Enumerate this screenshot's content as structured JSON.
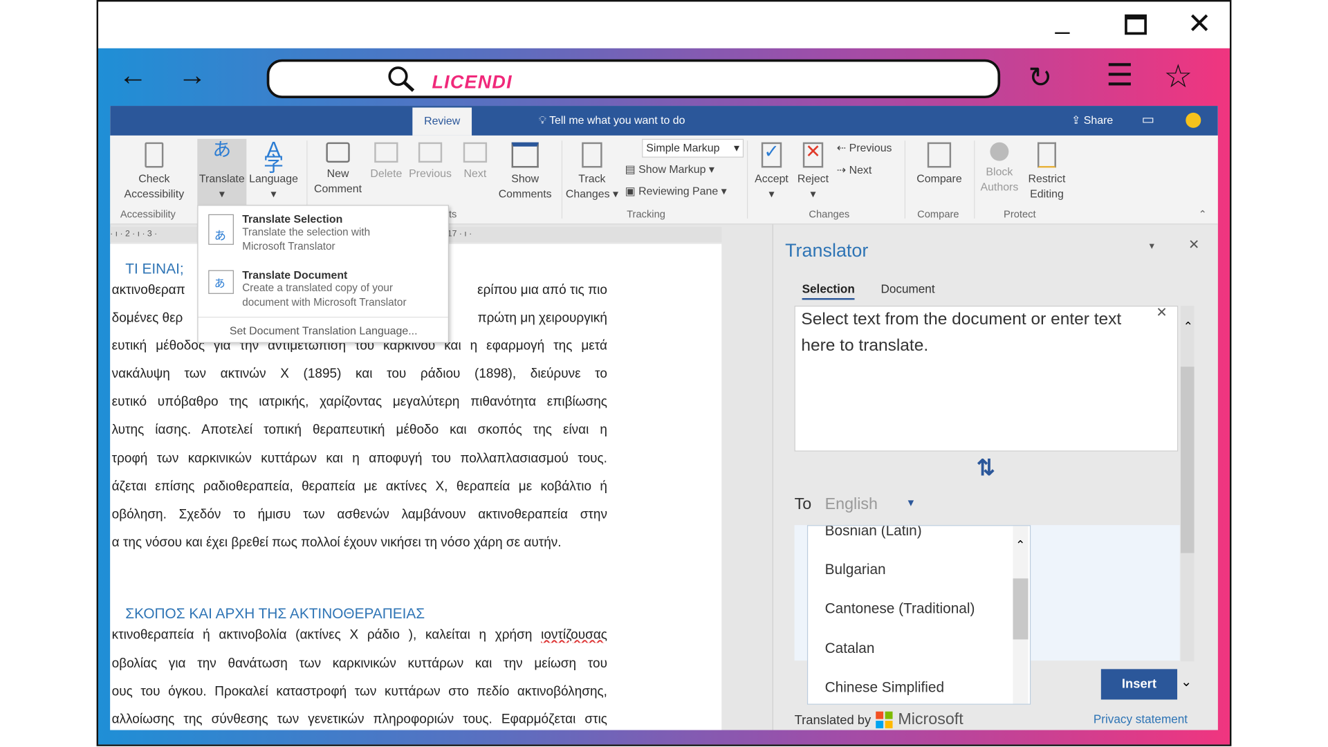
{
  "browser": {
    "logo": "LICENDI",
    "icons": [
      "back-arrow",
      "forward-arrow",
      "search",
      "reload",
      "hamburger-menu",
      "star",
      "minimize",
      "maximize",
      "close"
    ]
  },
  "word": {
    "active_tab": "Review",
    "tell_me": "Tell me what you want to do",
    "share": "Share",
    "ribbon": {
      "check_accessibility": "Check Accessibility",
      "translate": "Translate",
      "language": "Language",
      "new_comment": "New Comment",
      "delete": "Delete",
      "previous": "Previous",
      "next": "Next",
      "show_comments": "Show Comments",
      "track_changes": "Track Changes",
      "simple_markup": "Simple Markup",
      "show_markup": "Show Markup",
      "reviewing_pane": "Reviewing Pane",
      "accept": "Accept",
      "reject": "Reject",
      "prev_change": "Previous",
      "next_change": "Next",
      "compare": "Compare",
      "block_authors": "Block Authors",
      "restrict_editing": "Restrict Editing",
      "groups": {
        "accessibility": "Accessibility",
        "comments_tail": "ts",
        "tracking": "Tracking",
        "changes": "Changes",
        "compare": "Compare",
        "protect": "Protect"
      }
    },
    "ruler": "· ı · 2 · ı · 3 ·                                                   ı · 11 · ı · 12 · ı · 13 · ı · 14 · ı · 15 · ı · 16 · ı · 17 · ı ·",
    "translate_menu": {
      "selection_title": "Translate Selection",
      "selection_desc": "Translate the selection with Microsoft Translator",
      "document_title": "Translate Document",
      "document_desc": "Create a translated copy of your document with Microsoft Translator",
      "set_language": "Set Document Translation Language..."
    },
    "document": {
      "heading1": "ΤΙ ΕΙΝΑΙ;",
      "p1_l1a": "ακτινοθεραπ",
      "p1_l1b": "ερίπου μια από τις πιο",
      "p1_l2a": "δομένες θερ",
      "p1_l2b": "πρώτη μη χειρουργική",
      "p1": [
        "ευτική μέθοδος για την αντιμετώπιση του καρκίνου και η εφαρμογή της μετά",
        "νακάλυψη των ακτινών Χ (1895) και του ράδιου (1898), διεύρυνε το",
        "ευτικό υπόβαθρο της ιατρικής, χαρίζοντας μεγαλύτερη πιθανότητα επιβίωσης",
        "λυτης ίασης.  Αποτελεί τοπική θεραπευτική μέθοδο και σκοπός της είναι η",
        "τροφή των καρκινικών κυττάρων και η αποφυγή του πολλαπλασιασμού τους.",
        "άζεται επίσης ραδιοθεραπεία, θεραπεία με ακτίνες Χ, θεραπεία με κοβάλτιο ή",
        "οβόληση. Σχεδόν το ήμισυ των ασθενών λαμβάνουν ακτινοθεραπεία στην",
        "α της νόσου και έχει βρεθεί  πως πολλοί έχουν νικήσει τη νόσο χάρη σε αυτήν."
      ],
      "heading2": "ΣΚΟΠΟΣ ΚΑΙ ΑΡΧΗ ΤΗΣ ΑΚΤΙΝΟΘΕΡΑΠΕΙΑΣ",
      "p2_l1": "κτινοθεραπεία ή ακτινοβολία (ακτίνες Χ ράδιο ), καλείται η χρήση ",
      "p2_l1_misspelled": "ιοντίζουσας",
      "p2": [
        "οβολίας για την θανάτωση των καρκινικών κυττάρων και την μείωση του",
        "ους του όγκου. Προκαλεί καταστροφή των κυττάρων στο πεδίο ακτινοβόλησης,",
        " αλλοίωσης της σύνθεσης των γενετικών πληροφοριών τους. Εφαρμόζεται στις"
      ]
    },
    "translator": {
      "title": "Translator",
      "tabs": [
        "Selection",
        "Document"
      ],
      "active_tab": "Selection",
      "input_placeholder": "Select text from the document or enter text here to translate.",
      "to_label": "To",
      "to_value": "English",
      "languages": [
        "Bosnian (Latin)",
        "Bulgarian",
        "Cantonese (Traditional)",
        "Catalan",
        "Chinese Simplified"
      ],
      "insert": "Insert",
      "translated_by": "Translated by",
      "microsoft": "Microsoft",
      "privacy": "Privacy statement"
    }
  },
  "colors": {
    "word_blue": "#2b579a",
    "logo_pink": "#f0287a",
    "accent": "#2e74b5"
  }
}
